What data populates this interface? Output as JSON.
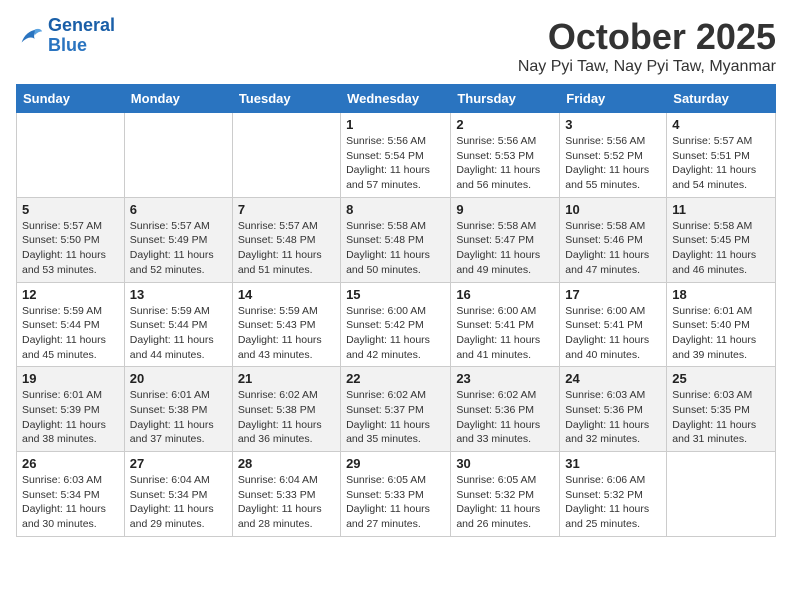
{
  "header": {
    "logo_line1": "General",
    "logo_line2": "Blue",
    "month": "October 2025",
    "location": "Nay Pyi Taw, Nay Pyi Taw, Myanmar"
  },
  "weekdays": [
    "Sunday",
    "Monday",
    "Tuesday",
    "Wednesday",
    "Thursday",
    "Friday",
    "Saturday"
  ],
  "weeks": [
    [
      {
        "day": "",
        "info": ""
      },
      {
        "day": "",
        "info": ""
      },
      {
        "day": "",
        "info": ""
      },
      {
        "day": "1",
        "info": "Sunrise: 5:56 AM\nSunset: 5:54 PM\nDaylight: 11 hours\nand 57 minutes."
      },
      {
        "day": "2",
        "info": "Sunrise: 5:56 AM\nSunset: 5:53 PM\nDaylight: 11 hours\nand 56 minutes."
      },
      {
        "day": "3",
        "info": "Sunrise: 5:56 AM\nSunset: 5:52 PM\nDaylight: 11 hours\nand 55 minutes."
      },
      {
        "day": "4",
        "info": "Sunrise: 5:57 AM\nSunset: 5:51 PM\nDaylight: 11 hours\nand 54 minutes."
      }
    ],
    [
      {
        "day": "5",
        "info": "Sunrise: 5:57 AM\nSunset: 5:50 PM\nDaylight: 11 hours\nand 53 minutes."
      },
      {
        "day": "6",
        "info": "Sunrise: 5:57 AM\nSunset: 5:49 PM\nDaylight: 11 hours\nand 52 minutes."
      },
      {
        "day": "7",
        "info": "Sunrise: 5:57 AM\nSunset: 5:48 PM\nDaylight: 11 hours\nand 51 minutes."
      },
      {
        "day": "8",
        "info": "Sunrise: 5:58 AM\nSunset: 5:48 PM\nDaylight: 11 hours\nand 50 minutes."
      },
      {
        "day": "9",
        "info": "Sunrise: 5:58 AM\nSunset: 5:47 PM\nDaylight: 11 hours\nand 49 minutes."
      },
      {
        "day": "10",
        "info": "Sunrise: 5:58 AM\nSunset: 5:46 PM\nDaylight: 11 hours\nand 47 minutes."
      },
      {
        "day": "11",
        "info": "Sunrise: 5:58 AM\nSunset: 5:45 PM\nDaylight: 11 hours\nand 46 minutes."
      }
    ],
    [
      {
        "day": "12",
        "info": "Sunrise: 5:59 AM\nSunset: 5:44 PM\nDaylight: 11 hours\nand 45 minutes."
      },
      {
        "day": "13",
        "info": "Sunrise: 5:59 AM\nSunset: 5:44 PM\nDaylight: 11 hours\nand 44 minutes."
      },
      {
        "day": "14",
        "info": "Sunrise: 5:59 AM\nSunset: 5:43 PM\nDaylight: 11 hours\nand 43 minutes."
      },
      {
        "day": "15",
        "info": "Sunrise: 6:00 AM\nSunset: 5:42 PM\nDaylight: 11 hours\nand 42 minutes."
      },
      {
        "day": "16",
        "info": "Sunrise: 6:00 AM\nSunset: 5:41 PM\nDaylight: 11 hours\nand 41 minutes."
      },
      {
        "day": "17",
        "info": "Sunrise: 6:00 AM\nSunset: 5:41 PM\nDaylight: 11 hours\nand 40 minutes."
      },
      {
        "day": "18",
        "info": "Sunrise: 6:01 AM\nSunset: 5:40 PM\nDaylight: 11 hours\nand 39 minutes."
      }
    ],
    [
      {
        "day": "19",
        "info": "Sunrise: 6:01 AM\nSunset: 5:39 PM\nDaylight: 11 hours\nand 38 minutes."
      },
      {
        "day": "20",
        "info": "Sunrise: 6:01 AM\nSunset: 5:38 PM\nDaylight: 11 hours\nand 37 minutes."
      },
      {
        "day": "21",
        "info": "Sunrise: 6:02 AM\nSunset: 5:38 PM\nDaylight: 11 hours\nand 36 minutes."
      },
      {
        "day": "22",
        "info": "Sunrise: 6:02 AM\nSunset: 5:37 PM\nDaylight: 11 hours\nand 35 minutes."
      },
      {
        "day": "23",
        "info": "Sunrise: 6:02 AM\nSunset: 5:36 PM\nDaylight: 11 hours\nand 33 minutes."
      },
      {
        "day": "24",
        "info": "Sunrise: 6:03 AM\nSunset: 5:36 PM\nDaylight: 11 hours\nand 32 minutes."
      },
      {
        "day": "25",
        "info": "Sunrise: 6:03 AM\nSunset: 5:35 PM\nDaylight: 11 hours\nand 31 minutes."
      }
    ],
    [
      {
        "day": "26",
        "info": "Sunrise: 6:03 AM\nSunset: 5:34 PM\nDaylight: 11 hours\nand 30 minutes."
      },
      {
        "day": "27",
        "info": "Sunrise: 6:04 AM\nSunset: 5:34 PM\nDaylight: 11 hours\nand 29 minutes."
      },
      {
        "day": "28",
        "info": "Sunrise: 6:04 AM\nSunset: 5:33 PM\nDaylight: 11 hours\nand 28 minutes."
      },
      {
        "day": "29",
        "info": "Sunrise: 6:05 AM\nSunset: 5:33 PM\nDaylight: 11 hours\nand 27 minutes."
      },
      {
        "day": "30",
        "info": "Sunrise: 6:05 AM\nSunset: 5:32 PM\nDaylight: 11 hours\nand 26 minutes."
      },
      {
        "day": "31",
        "info": "Sunrise: 6:06 AM\nSunset: 5:32 PM\nDaylight: 11 hours\nand 25 minutes."
      },
      {
        "day": "",
        "info": ""
      }
    ]
  ]
}
